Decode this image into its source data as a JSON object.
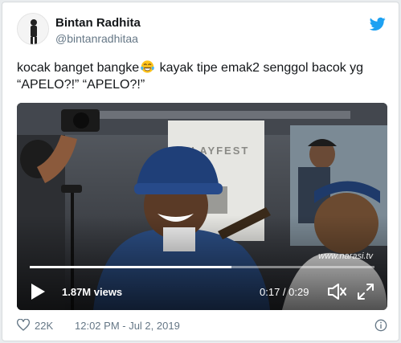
{
  "author": {
    "name": "Bintan Radhita",
    "handle": "@bintanradhitaa"
  },
  "tweet": {
    "text_before_emoji": "kocak banget bangke",
    "emoji": "face-with-tears-of-joy",
    "text_after_emoji": " kayak tipe emak2 senggol bacok yg",
    "line2": "“APELO?!” “APELO?!”"
  },
  "video": {
    "views": "1.87M views",
    "time": "0:17 / 0:29",
    "progress": 0.586,
    "watermark": "www.narasi.tv",
    "banner_text": "PLAYFEST"
  },
  "footer": {
    "likes": "22K",
    "timestamp": "12:02 PM - Jul 2, 2019"
  },
  "colors": {
    "twitter_blue": "#1da1f2",
    "text_primary": "#14171a",
    "text_secondary": "#657786"
  }
}
